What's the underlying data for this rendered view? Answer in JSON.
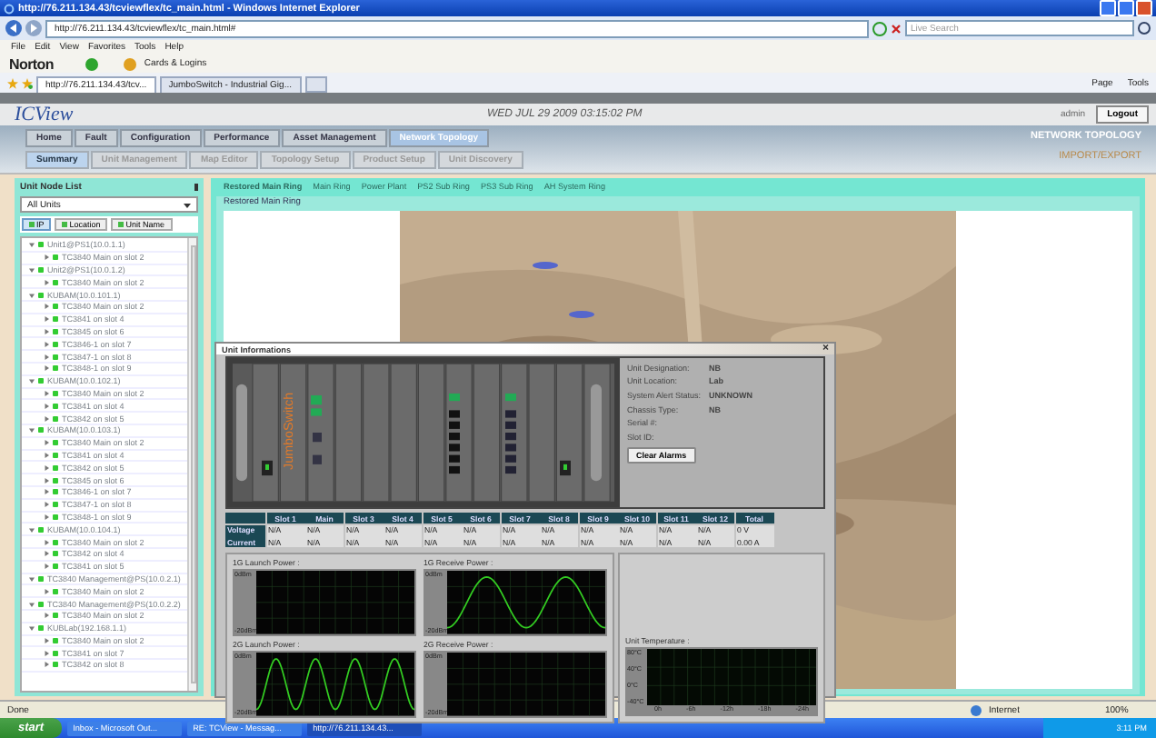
{
  "browser": {
    "title": "http://76.211.134.43/tcviewflex/tc_main.html - Windows Internet Explorer",
    "address": "http://76.211.134.43/tcviewflex/tc_main.html#",
    "search_placeholder": "Live Search",
    "menu": [
      "File",
      "Edit",
      "View",
      "Favorites",
      "Tools",
      "Help"
    ],
    "norton": {
      "brand": "Norton",
      "cards": "Cards & Logins"
    },
    "tabs": [
      {
        "label": "http://76.211.134.43/tcv...",
        "selected": true
      },
      {
        "label": "JumboSwitch - Industrial Gig...",
        "selected": false
      }
    ],
    "tools": [
      "Page",
      "Tools"
    ]
  },
  "app": {
    "logo": "ICView",
    "datetime": "WED JUL 29 2009 03:15:02 PM",
    "user": "admin",
    "logout": "Logout",
    "nav": [
      {
        "label": "Home",
        "selected": false
      },
      {
        "label": "Fault",
        "selected": false
      },
      {
        "label": "Configuration",
        "selected": false
      },
      {
        "label": "Performance",
        "selected": false
      },
      {
        "label": "Asset Management",
        "selected": false
      },
      {
        "label": "Network Topology",
        "selected": true
      }
    ],
    "subnav": [
      {
        "label": "Summary",
        "selected": true
      },
      {
        "label": "Unit Management",
        "selected": false
      },
      {
        "label": "Map Editor",
        "selected": false
      },
      {
        "label": "Topology Setup",
        "selected": false
      },
      {
        "label": "Product Setup",
        "selected": false
      },
      {
        "label": "Unit Discovery",
        "selected": false
      }
    ],
    "section_title": "NETWORK TOPOLOGY",
    "import_export": "IMPORT/EXPORT"
  },
  "node_list": {
    "title": "Unit Node List",
    "filter": "All Units",
    "sort_buttons": [
      {
        "label": "IP",
        "selected": true
      },
      {
        "label": "Location",
        "selected": false
      },
      {
        "label": "Unit Name",
        "selected": false
      }
    ],
    "tree": [
      {
        "label": "Unit1@PS1(10.0.1.1)",
        "expanded": true,
        "children": [
          {
            "label": "TC3840 Main on slot 2",
            "expanded": false
          }
        ]
      },
      {
        "label": "Unit2@PS1(10.0.1.2)",
        "expanded": true,
        "children": [
          {
            "label": "TC3840 Main on slot 2",
            "expanded": false
          }
        ]
      },
      {
        "label": "KUBAM(10.0.101.1)",
        "expanded": true,
        "children": [
          {
            "label": "TC3840 Main on slot 2",
            "expanded": false
          },
          {
            "label": "TC3841 on slot 4",
            "expanded": false
          },
          {
            "label": "TC3845 on slot 6",
            "expanded": false
          },
          {
            "label": "TC3846-1 on slot 7",
            "expanded": false
          },
          {
            "label": "TC3847-1 on slot 8",
            "expanded": false
          },
          {
            "label": "TC3848-1 on slot 9",
            "expanded": false
          }
        ]
      },
      {
        "label": "KUBAM(10.0.102.1)",
        "expanded": true,
        "children": [
          {
            "label": "TC3840 Main on slot 2",
            "expanded": false
          },
          {
            "label": "TC3841 on slot 4",
            "expanded": false
          },
          {
            "label": "TC3842 on slot 5",
            "expanded": false
          }
        ]
      },
      {
        "label": "KUBAM(10.0.103.1)",
        "expanded": true,
        "children": [
          {
            "label": "TC3840 Main on slot 2",
            "expanded": false
          },
          {
            "label": "TC3841 on slot 4",
            "expanded": false
          },
          {
            "label": "TC3842 on slot 5",
            "expanded": false
          },
          {
            "label": "TC3845 on slot 6",
            "expanded": false
          },
          {
            "label": "TC3846-1 on slot 7",
            "expanded": false
          },
          {
            "label": "TC3847-1 on slot 8",
            "expanded": false
          },
          {
            "label": "TC3848-1 on slot 9",
            "expanded": false
          }
        ]
      },
      {
        "label": "KUBAM(10.0.104.1)",
        "expanded": true,
        "children": [
          {
            "label": "TC3840 Main on slot 2",
            "expanded": false
          },
          {
            "label": "TC3842 on slot 4",
            "expanded": false
          },
          {
            "label": "TC3841 on slot 5",
            "expanded": false
          }
        ]
      },
      {
        "label": "TC3840 Management@PS(10.0.2.1)",
        "expanded": true,
        "children": [
          {
            "label": "TC3840 Main on slot 2",
            "expanded": false
          }
        ]
      },
      {
        "label": "TC3840 Management@PS(10.0.2.2)",
        "expanded": true,
        "children": [
          {
            "label": "TC3840 Main on slot 2",
            "expanded": false
          }
        ]
      },
      {
        "label": "KUBLab(192.168.1.1)",
        "expanded": true,
        "children": [
          {
            "label": "TC3840 Main on slot 2",
            "expanded": false
          },
          {
            "label": "TC3841 on slot 7",
            "expanded": false
          },
          {
            "label": "TC3842 on slot 8",
            "expanded": false
          }
        ]
      }
    ]
  },
  "rings": [
    {
      "label": "Restored Main Ring",
      "selected": true
    },
    {
      "label": "Main Ring",
      "selected": false
    },
    {
      "label": "Power Plant",
      "selected": false
    },
    {
      "label": "PS2 Sub Ring",
      "selected": false
    },
    {
      "label": "PS3 Sub Ring",
      "selected": false
    },
    {
      "label": "AH System Ring",
      "selected": false
    }
  ],
  "map": {
    "title": "Restored Main Ring",
    "kind": "picture"
  },
  "unit_info": {
    "title": "Unit Informations",
    "close": "×",
    "chassis_brand": "JumboSwitch",
    "fields": [
      {
        "label": "Unit Designation:",
        "value": "NB"
      },
      {
        "label": "Unit Location:",
        "value": "Lab"
      },
      {
        "label": "System Alert Status:",
        "value": "UNKNOWN"
      },
      {
        "label": "Chassis Type:",
        "value": "NB"
      },
      {
        "label": "Serial #:"
      },
      {
        "label": "Slot ID:"
      }
    ],
    "clear_button": "Clear Alarms",
    "table": {
      "columns": [
        "Slot 1",
        "Main",
        "Slot 3",
        "Slot 4",
        "Slot 5",
        "Slot 6",
        "Slot 7",
        "Slot 8",
        "Slot 9",
        "Slot 10",
        "Slot 11",
        "Slot 12",
        "Total"
      ],
      "rows": [
        {
          "label": "Voltage",
          "cells": [
            "N/A",
            "N/A",
            "N/A",
            "N/A",
            "N/A",
            "N/A",
            "N/A",
            "N/A",
            "N/A",
            "N/A",
            "N/A",
            "N/A",
            "0 V"
          ]
        },
        {
          "label": "Current",
          "cells": [
            "N/A",
            "N/A",
            "N/A",
            "N/A",
            "N/A",
            "N/A",
            "N/A",
            "N/A",
            "N/A",
            "N/A",
            "N/A",
            "N/A",
            "0.00 A"
          ]
        }
      ]
    },
    "graphs": [
      {
        "title": "1G Launch Power :",
        "y_top": "0dBm",
        "y_bottom": "-20dBm",
        "kind": "empty"
      },
      {
        "title": "1G Receive Power :",
        "y_top": "0dBm",
        "y_bottom": "-20dBm",
        "kind": "wave"
      },
      {
        "title": "2G Launch Power :",
        "y_top": "0dBm",
        "y_bottom": "-20dBm",
        "kind": "fast-wave"
      },
      {
        "title": "2G Receive Power :",
        "y_top": "0dBm",
        "y_bottom": "-20dBm",
        "kind": "empty"
      }
    ],
    "temperature": {
      "title": "Unit Temperature :",
      "y_labels": [
        "80°C",
        "40°C",
        "0°C",
        "-40°C"
      ],
      "x_labels": [
        "0h",
        "-6h",
        "-12h",
        "-18h",
        "-24h"
      ]
    }
  },
  "status_bar": {
    "text": "Done",
    "zone": "Internet",
    "zoom": "100%"
  },
  "taskbar": {
    "start": "start",
    "items": [
      {
        "label": "Inbox - Microsoft Out...",
        "selected": false
      },
      {
        "label": "RE: TCView - Messag...",
        "selected": false
      },
      {
        "label": "http://76.211.134.43...",
        "selected": true
      }
    ],
    "clock": "3:11 PM"
  }
}
